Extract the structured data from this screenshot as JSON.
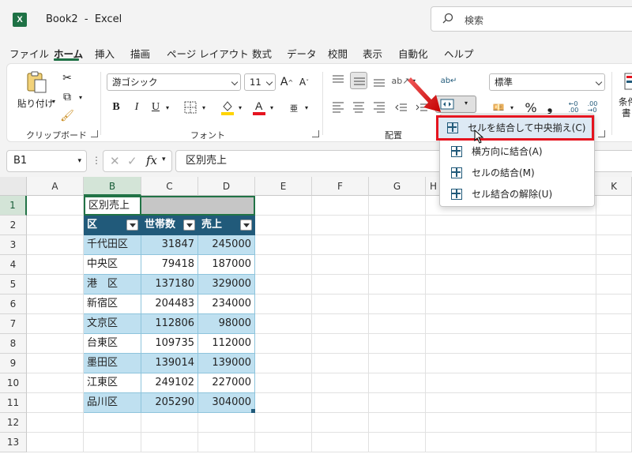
{
  "window": {
    "title": "Book2  -  Excel",
    "logo": "X"
  },
  "search": {
    "placeholder": "検索"
  },
  "tabs": [
    "ファイル",
    "ホーム",
    "挿入",
    "描画",
    "ページ レイアウト",
    "数式",
    "データ",
    "校閲",
    "表示",
    "自動化",
    "ヘルプ"
  ],
  "active_tab": "ホーム",
  "ribbon": {
    "clipboard": {
      "paste_label": "貼り付け",
      "group_label": "クリップボード"
    },
    "font": {
      "font_name": "游ゴシック",
      "font_size": "11",
      "group_label": "フォント",
      "bold": "B",
      "italic": "I",
      "underline": "U"
    },
    "alignment": {
      "group_label": "配置"
    },
    "number": {
      "format": "標準",
      "percent": "%",
      "comma": "❟"
    },
    "styles": {
      "partial_label_1": "条件",
      "partial_label_2": "書"
    }
  },
  "formula_bar": {
    "name_box": "B1",
    "fx": "fx",
    "value": "区別売上"
  },
  "columns": [
    "A",
    "B",
    "C",
    "D",
    "E",
    "F",
    "G",
    "H",
    "K"
  ],
  "rows": [
    "1",
    "2",
    "3",
    "4",
    "5",
    "6",
    "7",
    "8",
    "9",
    "10",
    "11",
    "12",
    "13"
  ],
  "sheet": {
    "title_cell": "区別売上",
    "headers": [
      "区",
      "世帯数",
      "売上"
    ],
    "data": [
      [
        "千代田区",
        "31847",
        "245000"
      ],
      [
        "中央区",
        "79418",
        "187000"
      ],
      [
        "港　区",
        "137180",
        "329000"
      ],
      [
        "新宿区",
        "204483",
        "234000"
      ],
      [
        "文京区",
        "112806",
        "98000"
      ],
      [
        "台東区",
        "109735",
        "112000"
      ],
      [
        "墨田区",
        "139014",
        "139000"
      ],
      [
        "江東区",
        "249102",
        "227000"
      ],
      [
        "品川区",
        "205290",
        "304000"
      ]
    ]
  },
  "merge_menu": {
    "items": [
      {
        "label": "セルを結合して中央揃え(C)",
        "highlighted": true
      },
      {
        "label": "横方向に結合(A)"
      },
      {
        "label": "セルの結合(M)"
      },
      {
        "label": "セル結合の解除(U)"
      }
    ]
  },
  "colors": {
    "accent": "#1e7145",
    "table_header": "#215a7a",
    "band": "#bfe0f0",
    "highlight": "#e5141f"
  }
}
